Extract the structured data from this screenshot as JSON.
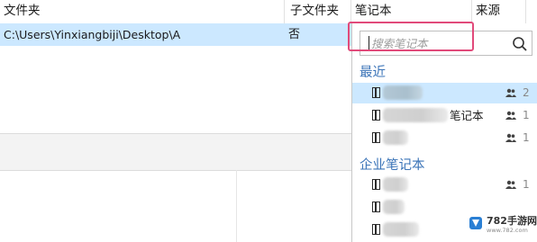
{
  "table": {
    "columns": [
      "文件夹",
      "子文件夹",
      "笔记本",
      "来源"
    ],
    "row": {
      "folder_path": "C:\\Users\\Yinxiangbiji\\Desktop\\A",
      "subfolder": "否"
    }
  },
  "dropdown": {
    "search": {
      "placeholder": "搜索笔记本",
      "value": ""
    },
    "recent": {
      "title": "最近",
      "items": [
        {
          "name": "",
          "count": "2",
          "selected": true
        },
        {
          "name": "笔记本",
          "count": "1"
        },
        {
          "name": "",
          "count": "1"
        }
      ]
    },
    "business": {
      "title": "企业笔记本",
      "items": [
        {
          "name": "",
          "count": "1"
        },
        {
          "name": "",
          "count": ""
        },
        {
          "name": "",
          "count": ""
        }
      ]
    }
  },
  "watermark": {
    "brand": "782手游网",
    "sub": "www.782.com"
  },
  "colors": {
    "selection": "#cce8ff",
    "accent_section": "#3b74b8",
    "highlight_box": "#e14a7a"
  }
}
